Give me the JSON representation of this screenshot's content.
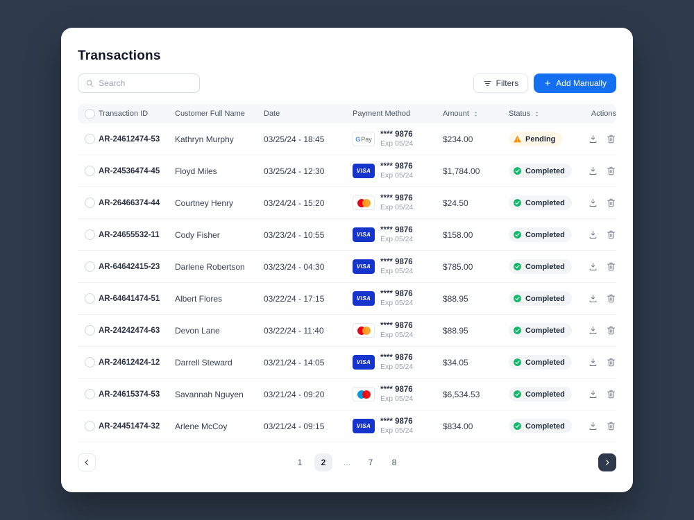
{
  "colors": {
    "background": "#2E3A4B",
    "accent_blue": "#1570EF",
    "pending_orange": "#F79009",
    "completed_green": "#12B76A",
    "visa_blue": "#1434CB"
  },
  "page": {
    "title": "Transactions"
  },
  "search": {
    "placeholder": "Search"
  },
  "toolbar": {
    "filters_label": "Filters",
    "add_label": "Add Manually"
  },
  "table": {
    "columns": [
      {
        "label": "Transaction ID",
        "sortable": false
      },
      {
        "label": "Customer Full Name",
        "sortable": false
      },
      {
        "label": "Date",
        "sortable": false
      },
      {
        "label": "Payment Method",
        "sortable": false
      },
      {
        "label": "Amount",
        "sortable": true
      },
      {
        "label": "Status",
        "sortable": true
      },
      {
        "label": "Actions",
        "sortable": false
      }
    ],
    "card_brands": {
      "visa": {
        "style": "label-solid",
        "label": "VISA"
      },
      "gpay": {
        "style": "label-duo",
        "label_primary": "G",
        "label_secondary": "Pay"
      },
      "mastercard": {
        "style": "circles",
        "colors": [
          "#EB001B",
          "#F79E1B"
        ]
      },
      "maestro": {
        "style": "circles",
        "colors": [
          "#0099DF",
          "#ED0006"
        ]
      }
    },
    "rows": [
      {
        "id": "AR-24612474-53",
        "customer": "Kathryn Murphy",
        "date": "03/25/24 - 18:45",
        "card": "gpay",
        "card_number": "**** 9876",
        "card_exp": "Exp 05/24",
        "amount": "$234.00",
        "status": "Pending"
      },
      {
        "id": "AR-24536474-45",
        "customer": "Floyd Miles",
        "date": "03/25/24 - 12:30",
        "card": "visa",
        "card_number": "**** 9876",
        "card_exp": "Exp 05/24",
        "amount": "$1,784.00",
        "status": "Completed"
      },
      {
        "id": "AR-26466374-44",
        "customer": "Courtney Henry",
        "date": "03/24/24 - 15:20",
        "card": "mastercard",
        "card_number": "**** 9876",
        "card_exp": "Exp 05/24",
        "amount": "$24.50",
        "status": "Completed"
      },
      {
        "id": "AR-24655532-11",
        "customer": "Cody Fisher",
        "date": "03/23/24 - 10:55",
        "card": "visa",
        "card_number": "**** 9876",
        "card_exp": "Exp 05/24",
        "amount": "$158.00",
        "status": "Completed"
      },
      {
        "id": "AR-64642415-23",
        "customer": "Darlene Robertson",
        "date": "03/23/24 - 04:30",
        "card": "visa",
        "card_number": "**** 9876",
        "card_exp": "Exp 05/24",
        "amount": "$785.00",
        "status": "Completed"
      },
      {
        "id": "AR-64641474-51",
        "customer": "Albert Flores",
        "date": "03/22/24 - 17:15",
        "card": "visa",
        "card_number": "**** 9876",
        "card_exp": "Exp 05/24",
        "amount": "$88.95",
        "status": "Completed"
      },
      {
        "id": "AR-24242474-63",
        "customer": "Devon Lane",
        "date": "03/22/24 - 11:40",
        "card": "mastercard",
        "card_number": "**** 9876",
        "card_exp": "Exp 05/24",
        "amount": "$88.95",
        "status": "Completed"
      },
      {
        "id": "AR-24612424-12",
        "customer": "Darrell Steward",
        "date": "03/21/24 - 14:05",
        "card": "visa",
        "card_number": "**** 9876",
        "card_exp": "Exp 05/24",
        "amount": "$34.05",
        "status": "Completed"
      },
      {
        "id": "AR-24615374-53",
        "customer": "Savannah Nguyen",
        "date": "03/21/24 - 09:20",
        "card": "maestro",
        "card_number": "**** 9876",
        "card_exp": "Exp 05/24",
        "amount": "$6,534.53",
        "status": "Completed"
      },
      {
        "id": "AR-24451474-32",
        "customer": "Arlene McCoy",
        "date": "03/21/24 - 09:15",
        "card": "visa",
        "card_number": "**** 9876",
        "card_exp": "Exp 05/24",
        "amount": "$834.00",
        "status": "Completed"
      }
    ]
  },
  "pagination": {
    "pages": [
      "1",
      "2",
      "...",
      "7",
      "8"
    ],
    "active": "2"
  }
}
